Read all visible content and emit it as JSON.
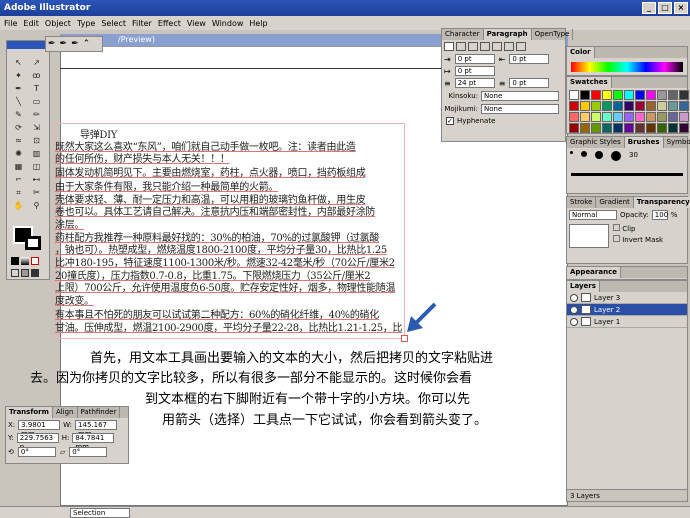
{
  "app": {
    "title": "Adobe Illustrator"
  },
  "menu": [
    "File",
    "Edit",
    "Object",
    "Type",
    "Select",
    "Filter",
    "Effect",
    "View",
    "Window",
    "Help"
  ],
  "document": {
    "title_fragment": "/Preview)"
  },
  "text_lines": [
    "导弹DIY",
    "既然大家这么喜欢“东风”，咱们就自己动手做一枚吧。注：读者由此造",
    "的任何所伤，财产损失与本人无关！！！",
    "固体发动机简明见下。主要由燃烧室，药柱，点火器，喷口，挡药板组成",
    "由于大家条件有限，我只能介绍一种最简单的火箭。",
    "壳体要求轻、薄、耐一定压力和高温，可以用粗的玻璃钓鱼杆做，用生皮",
    "卷也可以。具体工艺请自己解决。注意抗内压和端部密封性，内部最好涂防",
    "涂层。",
    "药柱配方我推荐一种原料最好找的：30%的柏油，70%的过氯酸钾（过氯酸",
    "，钠也可）。热塑成型，燃烧温度1800-2100度，平均分子量30，比热比1.25",
    "比冲180-195，特征速度1100-1300米/秒。燃速32-42毫米/秒（70公斤/厘米2",
    "20撞氏度），压力指数0.7-0.8，比重1.75。下限燃烧压力（35公斤/厘米2",
    "上限）700公斤，允许使用温度负6-50度。贮存安定性好，烟多，物理性能随温",
    "度改变。",
    "有本事且不怕死的朋友可以试试第二种配方：60%的硝化纤维，40%的硝化",
    "甘油。压伸成型，燃温2100-2900度，平均分子量22-28，比热比1.21-1.25，比"
  ],
  "caption_lines": [
    "首先，用文本工具画出要输入的文本的大小，然后把拷贝的文字粘贴进",
    "去。因为你拷贝的文字比较多，所以有很多一部分不能显示的。这时候你会看",
    "到文本框的右下脚附近有一个带十字的小方块。你可以先",
    "用箭头（选择）工具点一下它试试，你会看到箭头变了。"
  ],
  "paragraph_panel": {
    "tabs": [
      "Character",
      "Paragraph",
      "OpenType"
    ],
    "indent_left": "0 pt",
    "indent_right": "0 pt",
    "first_line": "0 pt",
    "space_before": "24 pt",
    "space_after": "0 pt",
    "kinsoku_label": "Kinsoku:",
    "kinsoku_value": "None",
    "mojikumi_label": "Mojikumi:",
    "mojikumi_value": "None",
    "hyphenate_label": "Hyphenate"
  },
  "color_panel": {
    "tab": "Color"
  },
  "swatches_panel": {
    "tab": "Swatches"
  },
  "brushes_panel": {
    "tabs": [
      "Graphic Styles",
      "Brushes",
      "Symbols"
    ],
    "size_label": "30"
  },
  "transparency_panel": {
    "tabs": [
      "Stroke",
      "Gradient",
      "Transparency"
    ],
    "mode": "Normal",
    "opacity_label": "Opacity:",
    "opacity": "100",
    "unit": "%",
    "clip": "Clip",
    "invert_mask": "Invert Mask"
  },
  "appearance_panel": {
    "tab": "Appearance"
  },
  "layers_panel": {
    "tab": "Layers",
    "layers": [
      "Layer 3",
      "Layer 2",
      "Layer 1"
    ],
    "footer": "3 Layers"
  },
  "transform_panel": {
    "tabs": [
      "Transform",
      "Align",
      "Pathfinder"
    ],
    "x_label": "X:",
    "x": "3.9801 mm",
    "y_label": "Y:",
    "y": "229.7563 n",
    "w_label": "W:",
    "w": "145.167 mm",
    "h_label": "H:",
    "h": "84.7841 mm",
    "rotate": "0°",
    "shear": "0°"
  },
  "status": {
    "zoom": "",
    "tool": "Selection"
  },
  "colors": {
    "accent": "#2b55b8",
    "selection_box": "#e9b3b3",
    "arrow": "#2a5bb0"
  }
}
